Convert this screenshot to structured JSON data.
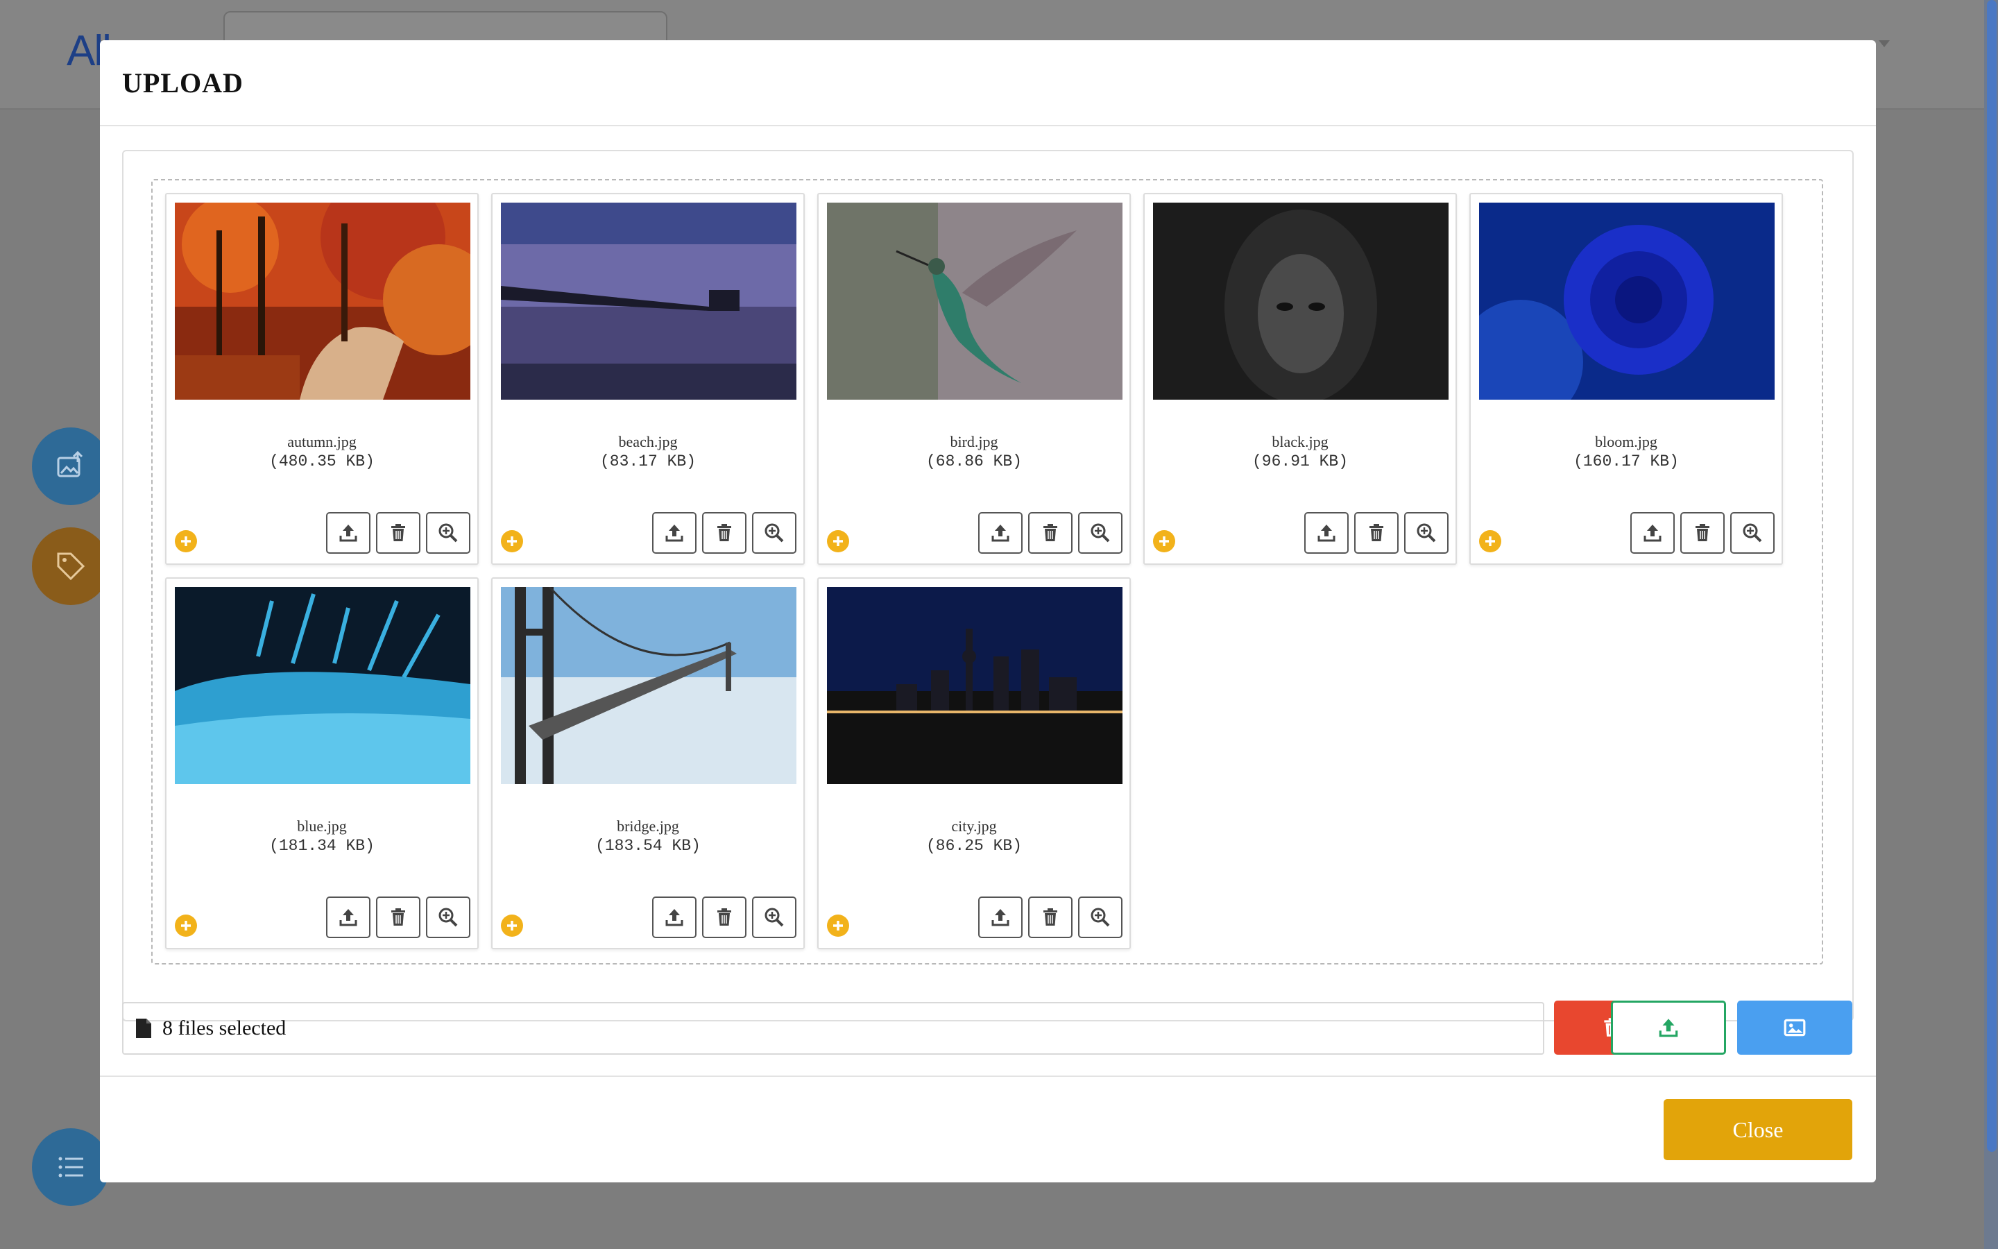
{
  "background": {
    "logo_text": "All",
    "nav_items": [
      "",
      "",
      "",
      "",
      ""
    ]
  },
  "modal": {
    "title": "UPLOAD",
    "files": [
      {
        "name": "autumn.jpg",
        "size": "(480.35 KB)"
      },
      {
        "name": "beach.jpg",
        "size": "(83.17 KB)"
      },
      {
        "name": "bird.jpg",
        "size": "(68.86 KB)"
      },
      {
        "name": "black.jpg",
        "size": "(96.91 KB)"
      },
      {
        "name": "bloom.jpg",
        "size": "(160.17 KB)"
      },
      {
        "name": "blue.jpg",
        "size": "(181.34 KB)"
      },
      {
        "name": "bridge.jpg",
        "size": "(183.54 KB)"
      },
      {
        "name": "city.jpg",
        "size": "(86.25 KB)"
      }
    ],
    "selection_text": "8 files selected",
    "close_label": "Close"
  },
  "colors": {
    "delete": "#e8472f",
    "upload": "#24a663",
    "browse": "#4a9ff0",
    "close": "#e2a40a",
    "add": "#f2b21a"
  }
}
